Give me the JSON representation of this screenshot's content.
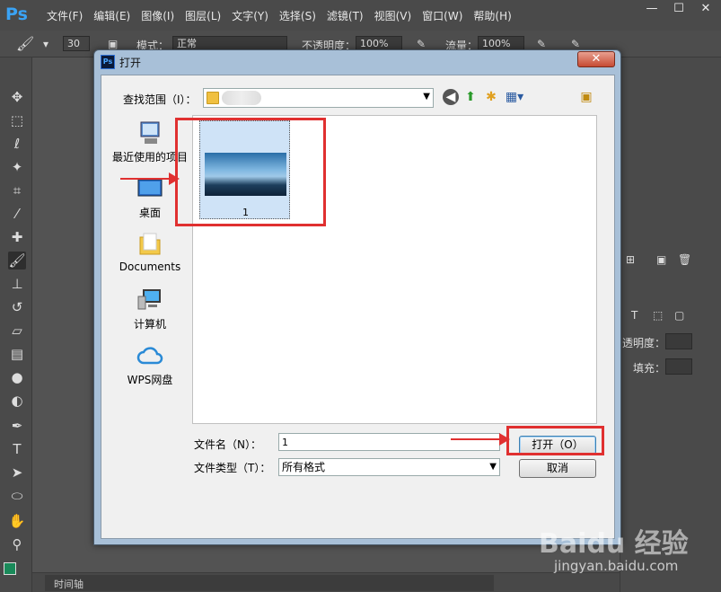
{
  "ps": {
    "logo": "Ps",
    "menu": [
      "文件(F)",
      "编辑(E)",
      "图像(I)",
      "图层(L)",
      "文字(Y)",
      "选择(S)",
      "滤镜(T)",
      "视图(V)",
      "窗口(W)",
      "帮助(H)"
    ],
    "options": {
      "brush_size": "30",
      "mode_label": "模式：",
      "mode_value": "正常",
      "opacity_label": "不透明度：",
      "opacity_value": "100%",
      "flow_label": "流量：",
      "flow_value": "100%"
    },
    "right_panel": {
      "opacity_label": "透明度：",
      "fill_label": "填充："
    },
    "timeline_label": "时间轴"
  },
  "dialog": {
    "title": "打开",
    "close_label": "✕",
    "lookin_label": "查找范围（I）：",
    "places": [
      {
        "label": "最近使用的项目",
        "icon": "recent-items-icon"
      },
      {
        "label": "桌面",
        "icon": "desktop-icon"
      },
      {
        "label": "Documents",
        "icon": "documents-folder-icon"
      },
      {
        "label": "计算机",
        "icon": "computer-icon"
      },
      {
        "label": "WPS网盘",
        "icon": "cloud-icon"
      }
    ],
    "file": {
      "name": "1"
    },
    "filename_label": "文件名（N）：",
    "filename_value": "1",
    "filetype_label": "文件类型（T）：",
    "filetype_value": "所有格式",
    "open_button": "打开（O）",
    "cancel_button": "取消"
  },
  "watermark": {
    "brand": "Baidu 经验",
    "url": "jingyan.baidu.com"
  },
  "colors": {
    "highlight": "#e03030",
    "ps_blue": "#3aa3f5",
    "dialog_frame": "#a8c0d8"
  }
}
